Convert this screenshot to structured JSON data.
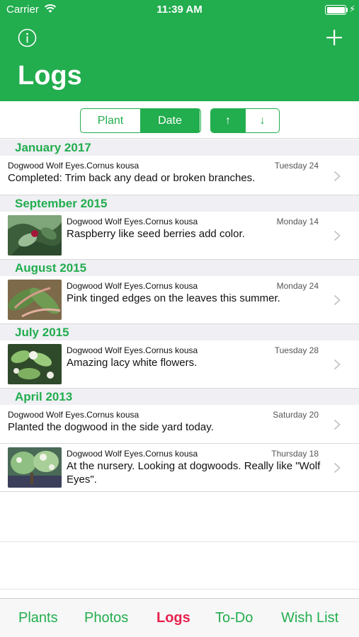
{
  "status": {
    "carrier": "Carrier",
    "time": "11:39 AM",
    "bolt": "⚡"
  },
  "header": {
    "title": "Logs",
    "info_icon": "info-circle-icon",
    "add_icon": "plus-icon"
  },
  "view_toggle": {
    "options": [
      "Plant",
      "Date"
    ],
    "selected": "Date"
  },
  "sort_toggle": {
    "options": [
      "↑",
      "↓"
    ]
  },
  "sections": [
    {
      "title": "January 2017",
      "rows": [
        {
          "plant": "Dogwood Wolf Eyes.Cornus kousa",
          "date": "Tuesday 24",
          "note": "Completed: Trim back any dead or broken branches.",
          "has_photo": false
        }
      ]
    },
    {
      "title": "September 2015",
      "rows": [
        {
          "plant": "Dogwood Wolf Eyes.Cornus kousa",
          "date": "Monday 14",
          "note": "Raspberry like seed berries add color.",
          "has_photo": true
        }
      ]
    },
    {
      "title": "August 2015",
      "rows": [
        {
          "plant": "Dogwood Wolf Eyes.Cornus kousa",
          "date": "Monday 24",
          "note": "Pink tinged edges on the leaves this summer.",
          "has_photo": true
        }
      ]
    },
    {
      "title": "July 2015",
      "rows": [
        {
          "plant": "Dogwood Wolf Eyes.Cornus kousa",
          "date": "Tuesday 28",
          "note": "Amazing lacy white flowers.",
          "has_photo": true
        }
      ]
    },
    {
      "title": "April 2013",
      "rows": [
        {
          "plant": "Dogwood Wolf Eyes.Cornus kousa",
          "date": "Saturday 20",
          "note": "Planted the dogwood in the side yard today.",
          "has_photo": false
        },
        {
          "plant": "Dogwood Wolf Eyes.Cornus kousa",
          "date": "Thursday 18",
          "note": "At the nursery. Looking at dogwoods. Really like \"Wolf Eyes\".",
          "has_photo": true
        }
      ]
    }
  ],
  "tabs": [
    "Plants",
    "Photos",
    "Logs",
    "To-Do",
    "Wish List"
  ],
  "active_tab": "Logs",
  "colors": {
    "accent": "#22ad4e",
    "active_tab": "#e8214e",
    "section_bg": "#efeff4"
  }
}
